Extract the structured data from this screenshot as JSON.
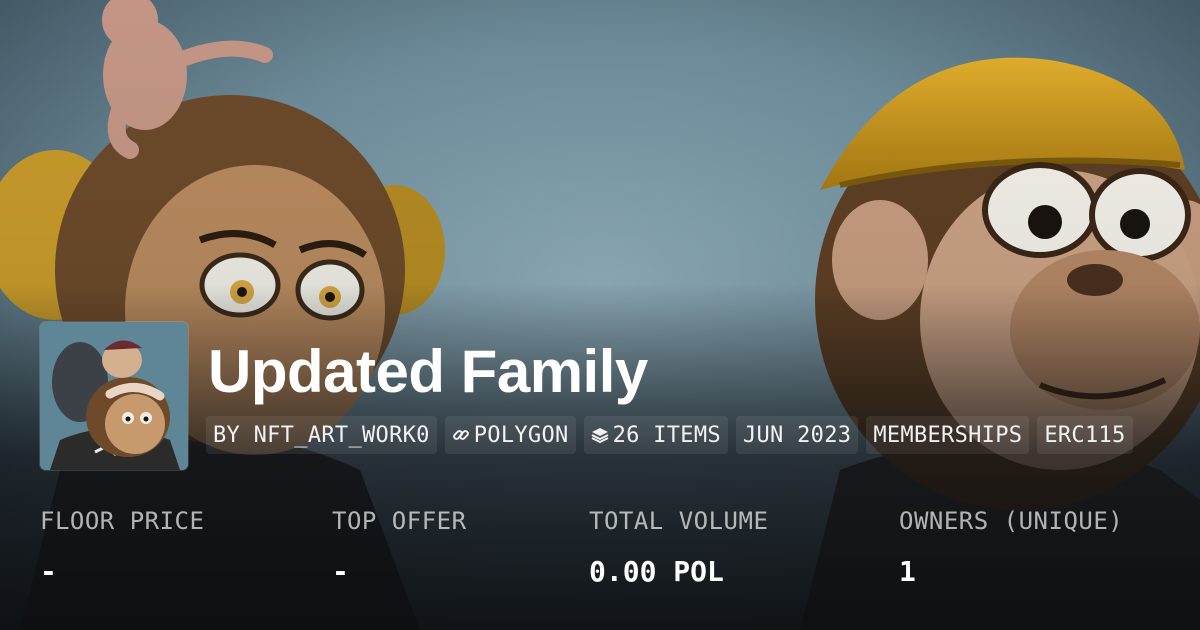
{
  "collection": {
    "title": "Updated Family"
  },
  "chips": [
    {
      "icon": "",
      "label": "BY NFT_ART_WORK0"
    },
    {
      "icon": "link-icon",
      "label": "POLYGON"
    },
    {
      "icon": "layers-icon",
      "label": "26 ITEMS"
    },
    {
      "icon": "",
      "label": "JUN 2023"
    },
    {
      "icon": "",
      "label": "MEMBERSHIPS"
    },
    {
      "icon": "",
      "label": "ERC115"
    }
  ],
  "stats": [
    {
      "label": "FLOOR PRICE",
      "value": "-"
    },
    {
      "label": "TOP OFFER",
      "value": "-"
    },
    {
      "label": "TOTAL VOLUME",
      "value": "0.00 POL"
    },
    {
      "label": "OWNERS (UNIQUE)",
      "value": "1"
    }
  ],
  "colors": {
    "background_sky": "#7a99a8",
    "text": "#ffffff",
    "muted_text": "#b5b5b5",
    "chip_bg": "rgba(255,255,255,0.08)"
  }
}
